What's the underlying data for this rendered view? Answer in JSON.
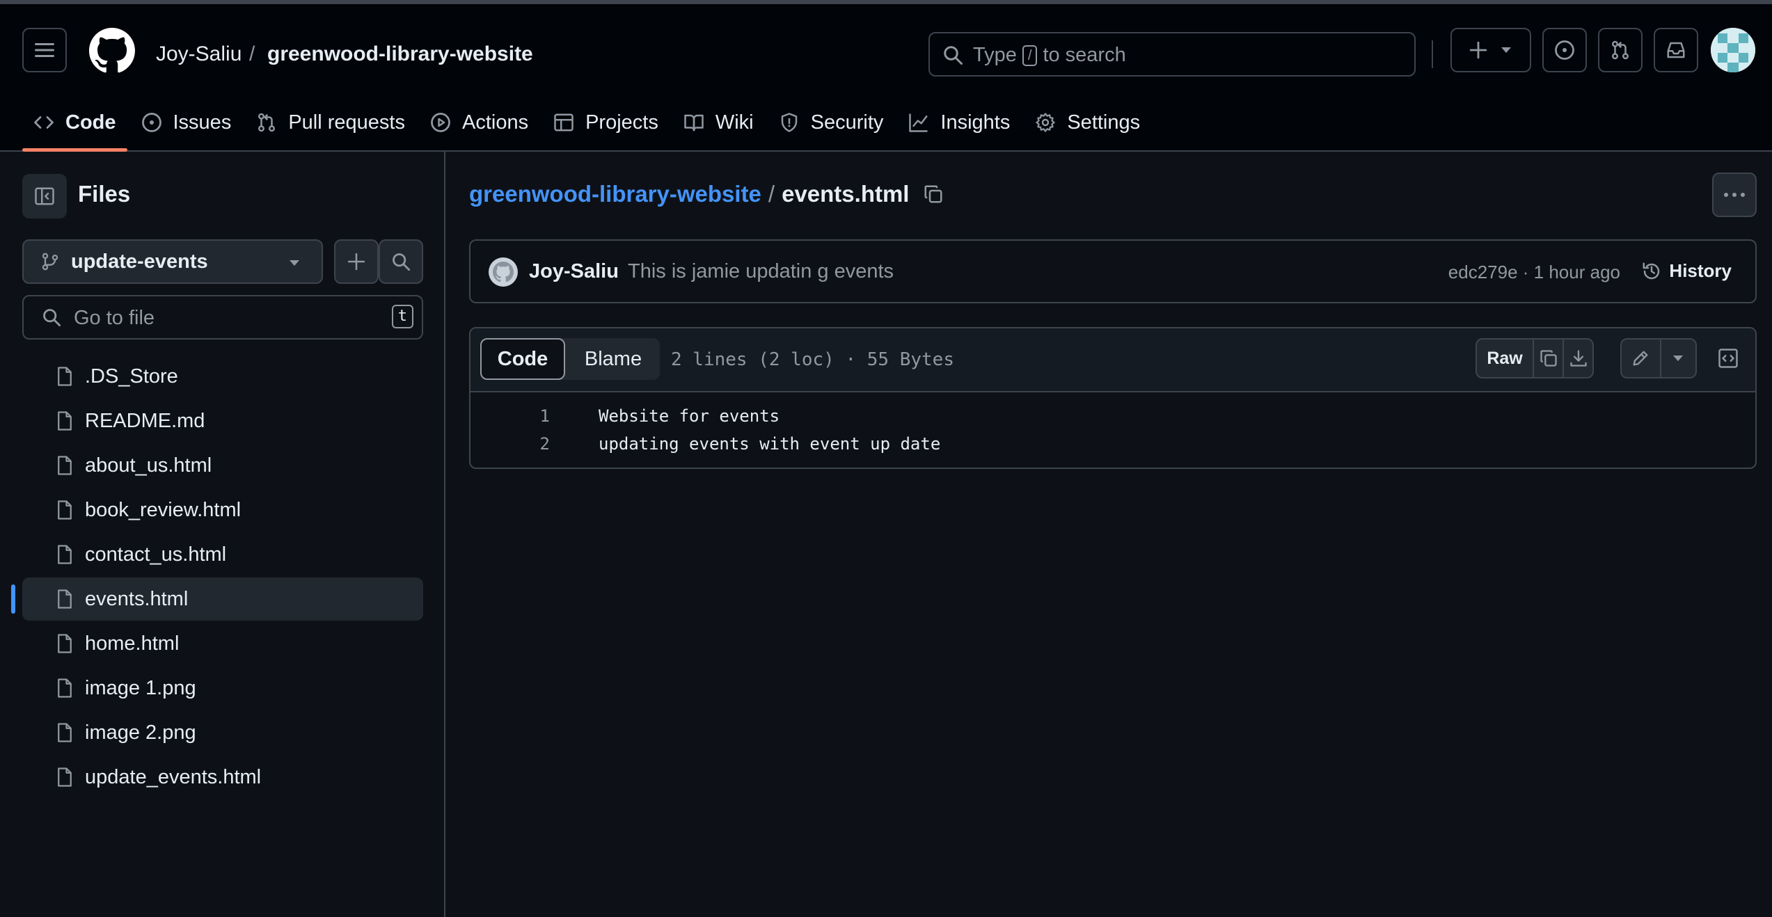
{
  "header": {
    "owner": "Joy-Saliu",
    "separator": "/",
    "repo": "greenwood-library-website",
    "search_prefix": "Type",
    "search_key": "/",
    "search_suffix": "to search"
  },
  "tabs": [
    {
      "label": "Code",
      "icon": "code-icon"
    },
    {
      "label": "Issues",
      "icon": "issue-icon"
    },
    {
      "label": "Pull requests",
      "icon": "pull-request-icon"
    },
    {
      "label": "Actions",
      "icon": "play-icon"
    },
    {
      "label": "Projects",
      "icon": "table-icon"
    },
    {
      "label": "Wiki",
      "icon": "book-icon"
    },
    {
      "label": "Security",
      "icon": "shield-icon"
    },
    {
      "label": "Insights",
      "icon": "graph-icon"
    },
    {
      "label": "Settings",
      "icon": "gear-icon"
    }
  ],
  "sidebar": {
    "title": "Files",
    "branch": "update-events",
    "goto_placeholder": "Go to file",
    "goto_key": "t",
    "files": [
      ".DS_Store",
      "README.md",
      "about_us.html",
      "book_review.html",
      "contact_us.html",
      "events.html",
      "home.html",
      "image 1.png",
      "image 2.png",
      "update_events.html"
    ],
    "selected": "events.html"
  },
  "breadcrumb": {
    "repo": "greenwood-library-website",
    "separator": "/",
    "file": "events.html"
  },
  "commit": {
    "author": "Joy-Saliu",
    "message": "This is jamie updatin g events",
    "meta": "edc279e · 1 hour ago",
    "history_label": "History"
  },
  "code_view": {
    "tab_code": "Code",
    "tab_blame": "Blame",
    "info": "2 lines (2 loc) · 55 Bytes",
    "raw_label": "Raw",
    "lines": [
      {
        "n": "1",
        "text": "Website for events"
      },
      {
        "n": "2",
        "text": "updating events with event up date"
      }
    ]
  },
  "colors": {
    "accent": "#4493f8",
    "tab_underline": "#f78166",
    "background": "#0d1117",
    "header": "#010409"
  }
}
